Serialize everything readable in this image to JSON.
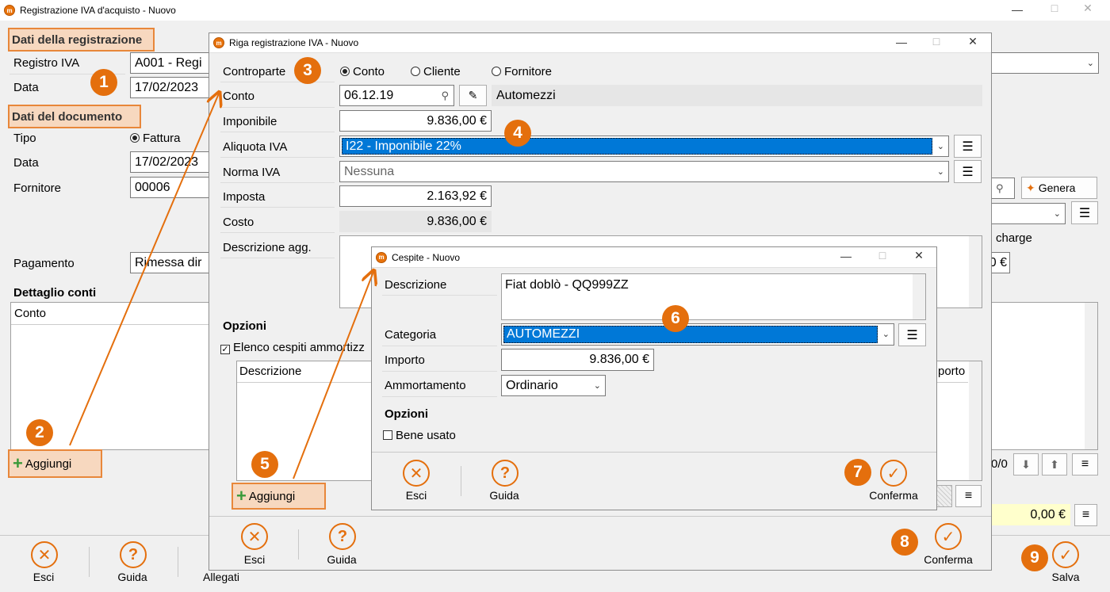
{
  "main": {
    "title": "Registrazione IVA d'acquisto - Nuovo",
    "sec_registrazione": "Dati della registrazione",
    "lbl_registro": "Registro IVA",
    "registro_value": "A001 - Regi",
    "lbl_data": "Data",
    "data_value": "17/02/2023",
    "sec_documento": "Dati del documento",
    "lbl_tipo": "Tipo",
    "tipo_value": "Fattura",
    "lbl_data_doc": "Data",
    "data_doc_value": "17/02/2023",
    "lbl_fornitore": "Fornitore",
    "fornitore_value": "00006",
    "genera_label": "Genera",
    "charge_text": "charge",
    "amount_partial": "0 €",
    "lbl_pagamento": "Pagamento",
    "pagamento_value": "Rimessa dir",
    "dettaglio_title": "Dettaglio conti",
    "col_conto": "Conto",
    "aggiungi_label": "Aggiungi",
    "page_counter": "0/0",
    "total_value": "0,00 €",
    "btn_esci": "Esci",
    "btn_guida": "Guida",
    "btn_allegati": "Allegati",
    "btn_salva": "Salva"
  },
  "riga": {
    "title": "Riga registrazione IVA - Nuovo",
    "lbl_controparte": "Controparte",
    "opt_conto": "Conto",
    "opt_cliente": "Cliente",
    "opt_fornitore": "Fornitore",
    "lbl_conto": "Conto",
    "conto_value": "06.12.19",
    "conto_desc": "Automezzi",
    "lbl_imponibile": "Imponibile",
    "imponibile_value": "9.836,00 €",
    "lbl_aliquota": "Aliquota IVA",
    "aliquota_value": "I22 - Imponibile 22%",
    "lbl_norma": "Norma IVA",
    "norma_value": "Nessuna",
    "lbl_imposta": "Imposta",
    "imposta_value": "2.163,92 €",
    "lbl_costo": "Costo",
    "costo_value": "9.836,00 €",
    "lbl_descrizione": "Descrizione agg.",
    "opzioni_title": "Opzioni",
    "chk_cespiti": "Elenco cespiti ammortizz",
    "col_descrizione": "Descrizione",
    "col_importo_partial": "porto",
    "aggiungi_label": "Aggiungi",
    "btn_esci": "Esci",
    "btn_guida": "Guida",
    "btn_conferma": "Conferma"
  },
  "cespite": {
    "title": "Cespite - Nuovo",
    "lbl_descrizione": "Descrizione",
    "descrizione_value": "Fiat doblò - QQ999ZZ",
    "lbl_categoria": "Categoria",
    "categoria_value": "AUTOMEZZI",
    "lbl_importo": "Importo",
    "importo_value": "9.836,00 €",
    "lbl_ammortamento": "Ammortamento",
    "ammortamento_value": "Ordinario",
    "opzioni_title": "Opzioni",
    "chk_bene_usato": "Bene usato",
    "btn_esci": "Esci",
    "btn_guida": "Guida",
    "btn_conferma": "Conferma"
  },
  "badges": [
    "1",
    "2",
    "3",
    "4",
    "5",
    "6",
    "7",
    "8",
    "9"
  ],
  "colors": {
    "accent": "#e46f0d",
    "highlight": "#f7d8bf",
    "selection": "#0078d7",
    "total_bg": "#ffffcc"
  }
}
